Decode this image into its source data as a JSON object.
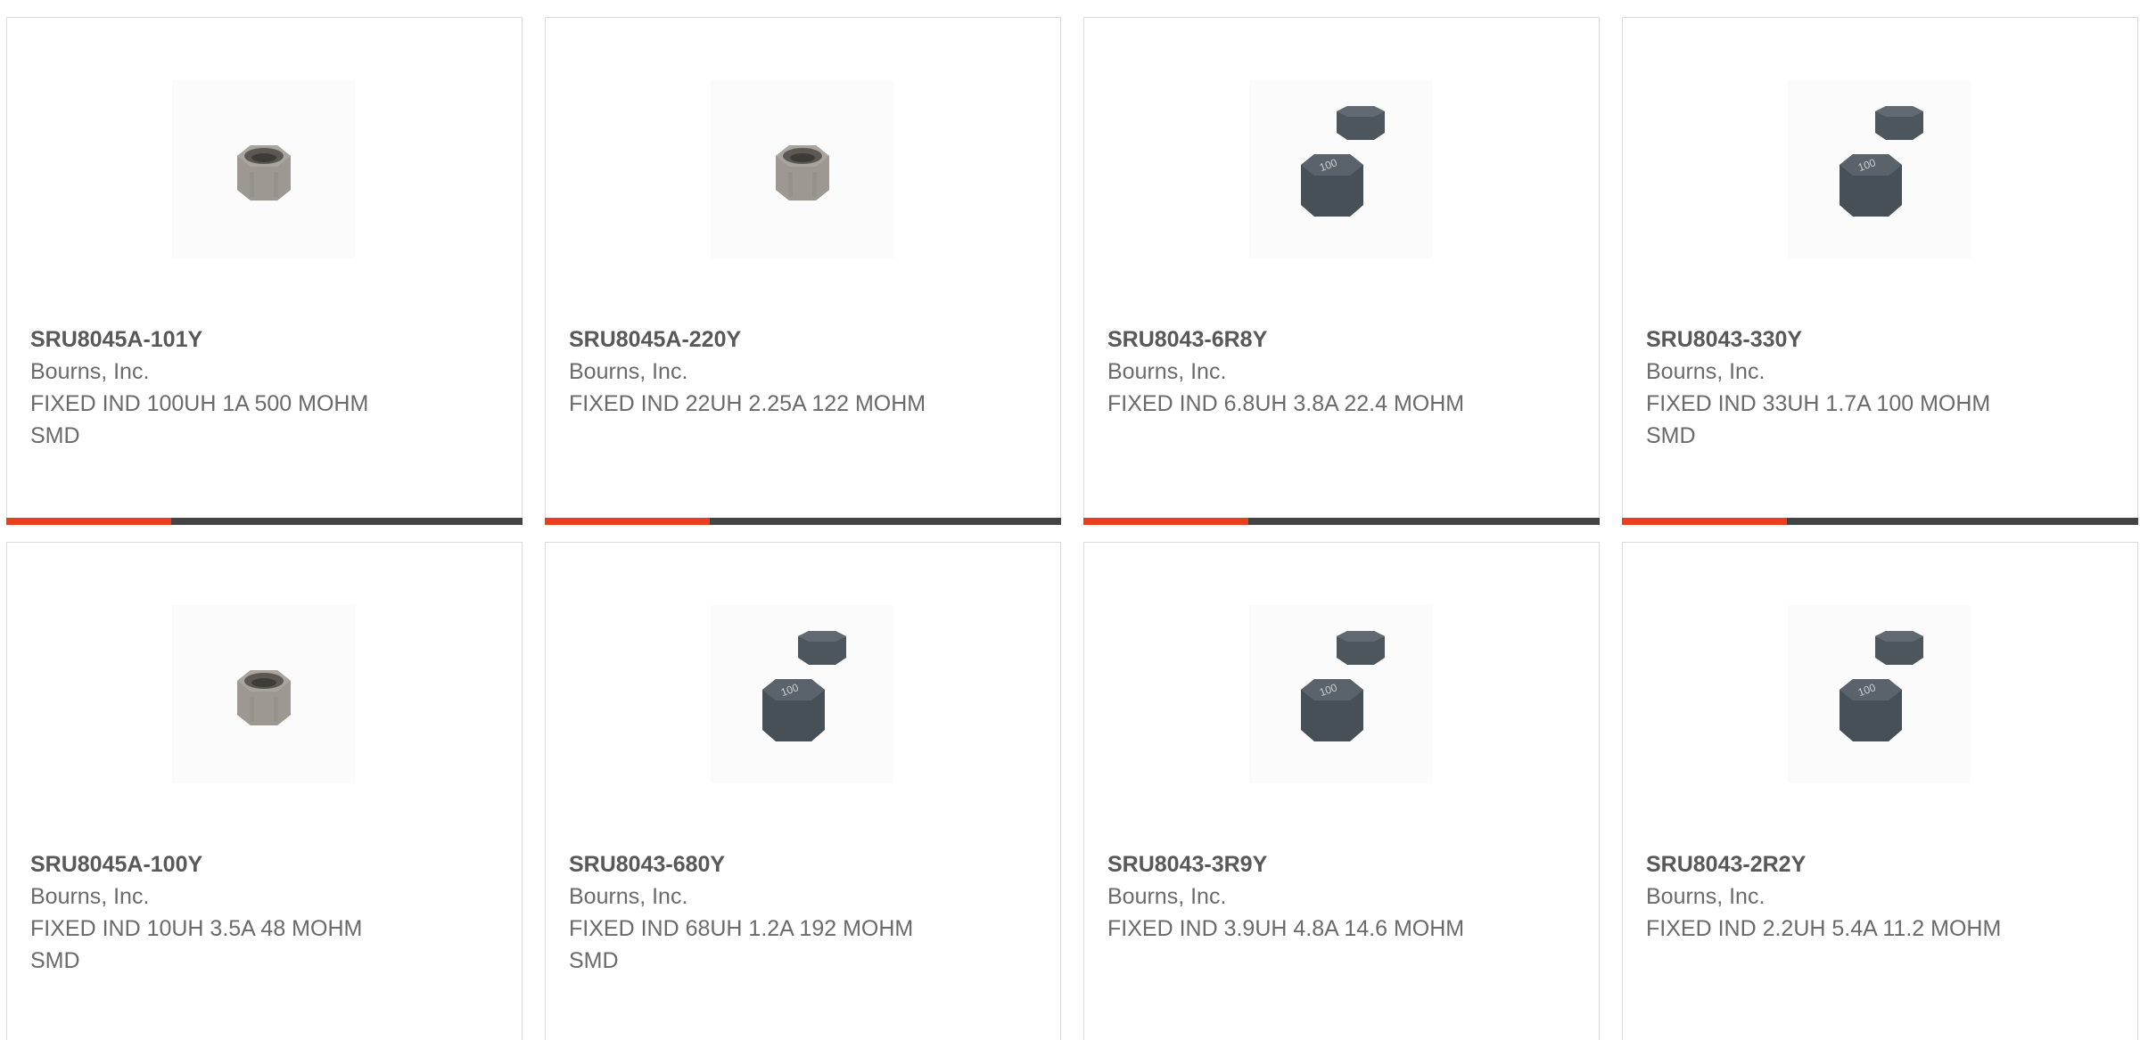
{
  "products": [
    {
      "part": "SRU8045A-101Y",
      "mfr": "Bourns, Inc.",
      "desc": "FIXED IND 100UH 1A 500 MOHM SMD",
      "image": "inductor-open-icon",
      "accent_progress": 0.32
    },
    {
      "part": "SRU8045A-220Y",
      "mfr": "Bourns, Inc.",
      "desc": "FIXED IND 22UH 2.25A 122 MOHM",
      "image": "inductor-open-icon",
      "accent_progress": 0.32
    },
    {
      "part": "SRU8043-6R8Y",
      "mfr": "Bourns, Inc.",
      "desc": "FIXED IND 6.8UH 3.8A 22.4 MOHM",
      "image": "inductor-pair-icon",
      "accent_progress": 0.32
    },
    {
      "part": "SRU8043-330Y",
      "mfr": "Bourns, Inc.",
      "desc": "FIXED IND 33UH 1.7A 100 MOHM SMD",
      "image": "inductor-pair-icon",
      "accent_progress": 0.32
    },
    {
      "part": "SRU8045A-100Y",
      "mfr": "Bourns, Inc.",
      "desc": "FIXED IND 10UH 3.5A 48 MOHM SMD",
      "image": "inductor-open-icon",
      "accent_progress": null
    },
    {
      "part": "SRU8043-680Y",
      "mfr": "Bourns, Inc.",
      "desc": "FIXED IND 68UH 1.2A 192 MOHM SMD",
      "image": "inductor-pair-icon",
      "accent_progress": null
    },
    {
      "part": "SRU8043-3R9Y",
      "mfr": "Bourns, Inc.",
      "desc": "FIXED IND 3.9UH 4.8A 14.6 MOHM",
      "image": "inductor-pair-icon",
      "accent_progress": null
    },
    {
      "part": "SRU8043-2R2Y",
      "mfr": "Bourns, Inc.",
      "desc": "FIXED IND 2.2UH 5.4A 11.2 MOHM",
      "image": "inductor-pair-icon",
      "accent_progress": null
    }
  ],
  "marking_text": "100",
  "colors": {
    "accent": "#e8401c",
    "bar": "#434343",
    "part_text": "#585858",
    "body_text": "#6a6a6a",
    "card_border": "#dadada"
  }
}
